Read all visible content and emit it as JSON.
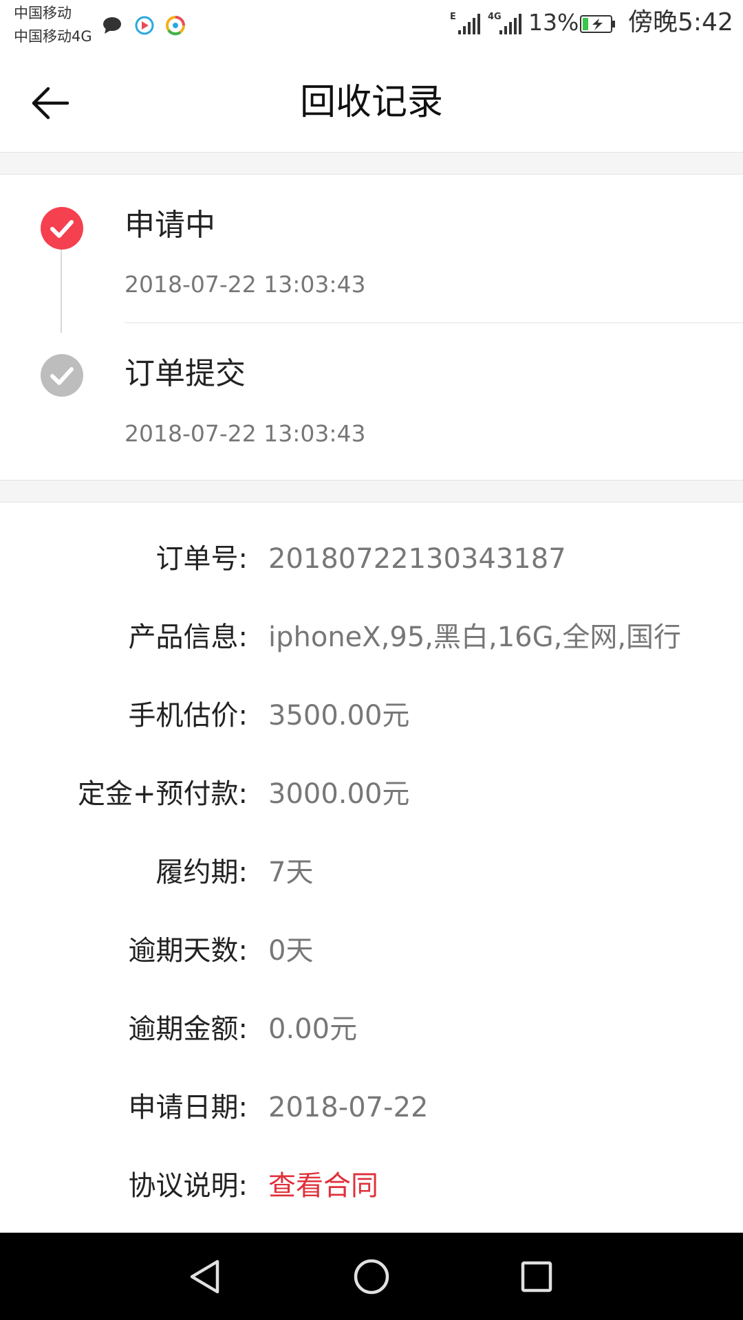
{
  "status_bar": {
    "carrier1": "中国移动",
    "carrier2": "中国移动4G",
    "signal1_label": "E",
    "signal2_label": "4G",
    "battery_pct": "13%",
    "time": "傍晚5:42"
  },
  "header": {
    "title": "回收记录"
  },
  "timeline": [
    {
      "title": "申请中",
      "time": "2018-07-22 13:03:43",
      "status": "active",
      "color": "#f5404f"
    },
    {
      "title": "订单提交",
      "time": "2018-07-22 13:03:43",
      "status": "done",
      "color": "#bdbdbd"
    }
  ],
  "details": [
    {
      "label": "订单号:",
      "value": "20180722130343187"
    },
    {
      "label": "产品信息:",
      "value": "iphoneX,95,黑白,16G,全网,国行"
    },
    {
      "label": "手机估价:",
      "value": "3500.00元"
    },
    {
      "label": "定金+预付款:",
      "value": "3000.00元"
    },
    {
      "label": "履约期:",
      "value": "7天"
    },
    {
      "label": "逾期天数:",
      "value": "0天"
    },
    {
      "label": "逾期金额:",
      "value": "0.00元"
    },
    {
      "label": "申请日期:",
      "value": "2018-07-22"
    },
    {
      "label": "协议说明:",
      "value": "查看合同",
      "link": true
    }
  ],
  "colors": {
    "accent_red": "#f5404f",
    "link_red": "#e0303a",
    "value_grey": "#777777"
  }
}
